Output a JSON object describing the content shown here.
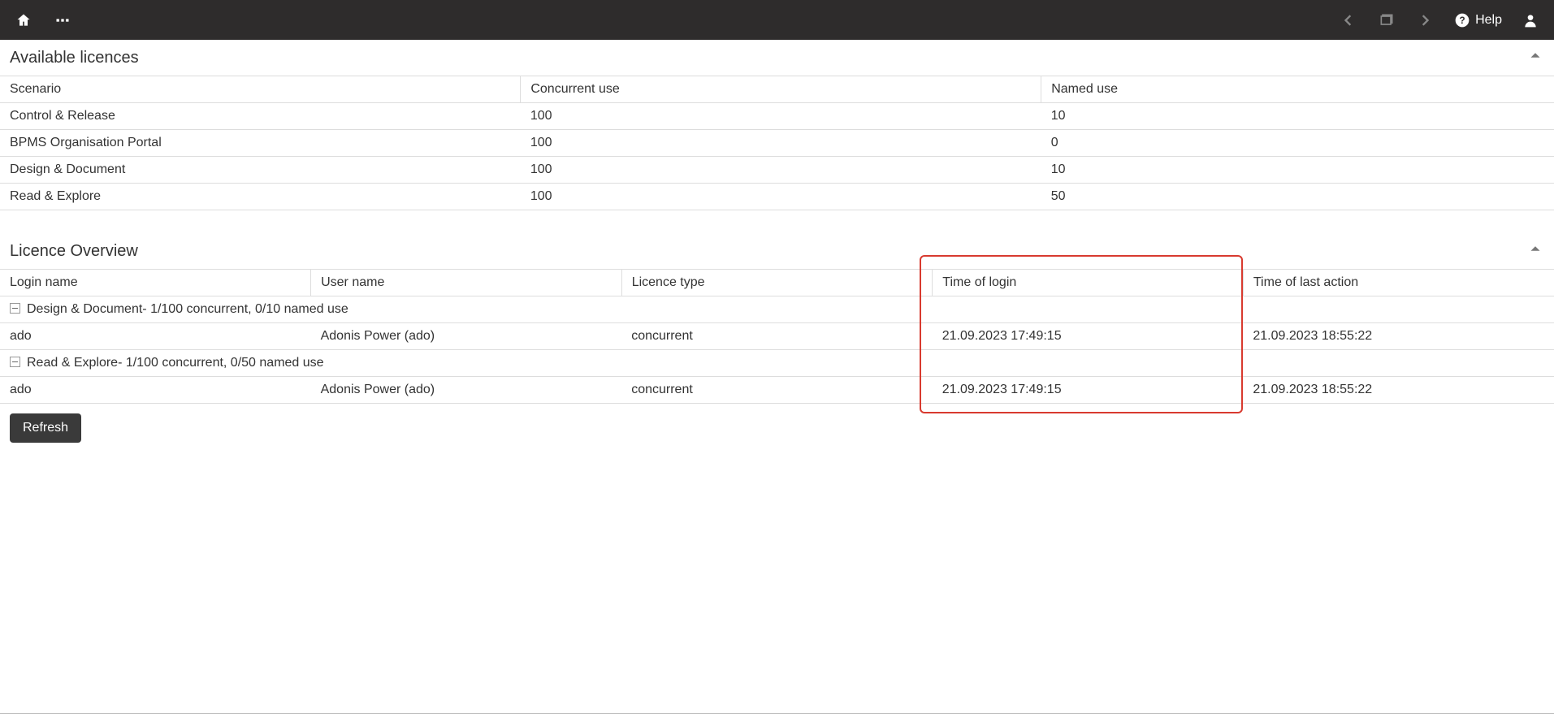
{
  "topbar": {
    "help_label": "Help"
  },
  "available": {
    "title": "Available licences",
    "columns": {
      "scenario": "Scenario",
      "concurrent": "Concurrent use",
      "named": "Named use"
    },
    "rows": [
      {
        "scenario": "Control & Release",
        "concurrent": "100",
        "named": "10"
      },
      {
        "scenario": "BPMS Organisation Portal",
        "concurrent": "100",
        "named": "0"
      },
      {
        "scenario": "Design & Document",
        "concurrent": "100",
        "named": "10"
      },
      {
        "scenario": "Read & Explore",
        "concurrent": "100",
        "named": "50"
      }
    ]
  },
  "overview": {
    "title": "Licence Overview",
    "columns": {
      "login_name": "Login name",
      "user_name": "User name",
      "licence_type": "Licence type",
      "time_login": "Time of login",
      "time_last": "Time of last action"
    },
    "groups": [
      {
        "label": "Design & Document- 1/100 concurrent, 0/10 named use",
        "rows": [
          {
            "login_name": "ado",
            "user_name": "Adonis Power (ado)",
            "licence_type": "concurrent",
            "time_login": "21.09.2023 17:49:15",
            "time_last": "21.09.2023 18:55:22"
          }
        ]
      },
      {
        "label": "Read & Explore- 1/100 concurrent, 0/50 named use",
        "rows": [
          {
            "login_name": "ado",
            "user_name": "Adonis Power (ado)",
            "licence_type": "concurrent",
            "time_login": "21.09.2023 17:49:15",
            "time_last": "21.09.2023 18:55:22"
          }
        ]
      }
    ]
  },
  "buttons": {
    "refresh": "Refresh"
  }
}
